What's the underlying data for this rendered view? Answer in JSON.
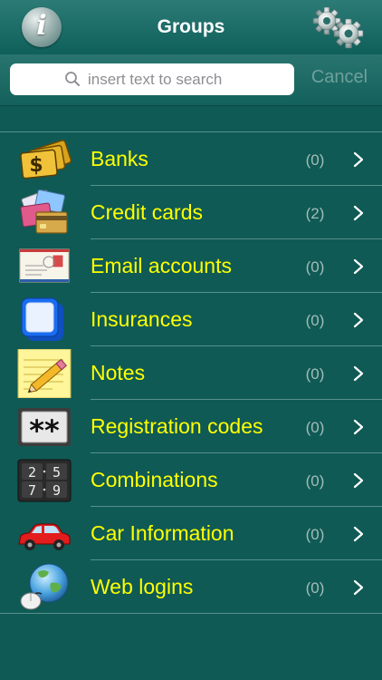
{
  "navbar": {
    "title": "Groups",
    "info_label": "i"
  },
  "search": {
    "placeholder": "insert text to search",
    "value": "",
    "cancel_label": "Cancel"
  },
  "groups": [
    {
      "label": "Banks",
      "count": "(0)",
      "icon": "money-icon"
    },
    {
      "label": "Credit cards",
      "count": "(2)",
      "icon": "credit-card-icon"
    },
    {
      "label": "Email accounts",
      "count": "(0)",
      "icon": "envelope-icon"
    },
    {
      "label": "Insurances",
      "count": "(0)",
      "icon": "insurance-card-icon"
    },
    {
      "label": "Notes",
      "count": "(0)",
      "icon": "notepad-icon"
    },
    {
      "label": "Registration codes",
      "count": "(0)",
      "icon": "asterisk-code-icon"
    },
    {
      "label": "Combinations",
      "count": "(0)",
      "icon": "number-keypad-icon"
    },
    {
      "label": "Car Information",
      "count": "(0)",
      "icon": "car-icon"
    },
    {
      "label": "Web logins",
      "count": "(0)",
      "icon": "globe-mouse-icon"
    }
  ],
  "icon_text": {
    "banks_symbol": "$",
    "registration_symbol": "**",
    "combination_digits": [
      "2",
      "5",
      "7",
      "9"
    ]
  },
  "colors": {
    "background": "#0f5a55",
    "label": "#ffff00",
    "count": "#a4bcb9",
    "separator": "#58908b"
  }
}
